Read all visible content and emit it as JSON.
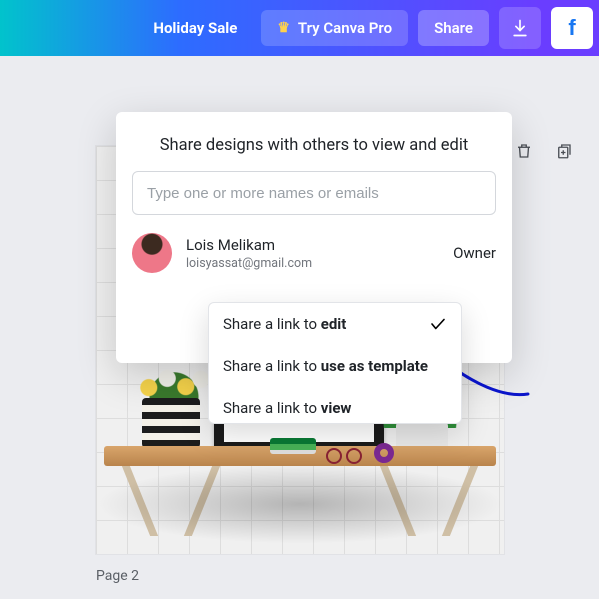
{
  "topbar": {
    "holiday_label": "Holiday Sale",
    "try_pro_label": "Try Canva Pro",
    "share_label": "Share"
  },
  "popover": {
    "title": "Share designs with others to view and edit",
    "input_placeholder": "Type one or more names or emails",
    "owner": {
      "name": "Lois Melikam",
      "email": "loisyassat@gmail.com",
      "role": "Owner"
    }
  },
  "link_menu": {
    "prefix": "Share a link to ",
    "options": [
      {
        "strong": "edit",
        "selected": true
      },
      {
        "strong": "use as template",
        "selected": false
      },
      {
        "strong": "view",
        "selected": false
      }
    ]
  },
  "page_label": "Page 2"
}
